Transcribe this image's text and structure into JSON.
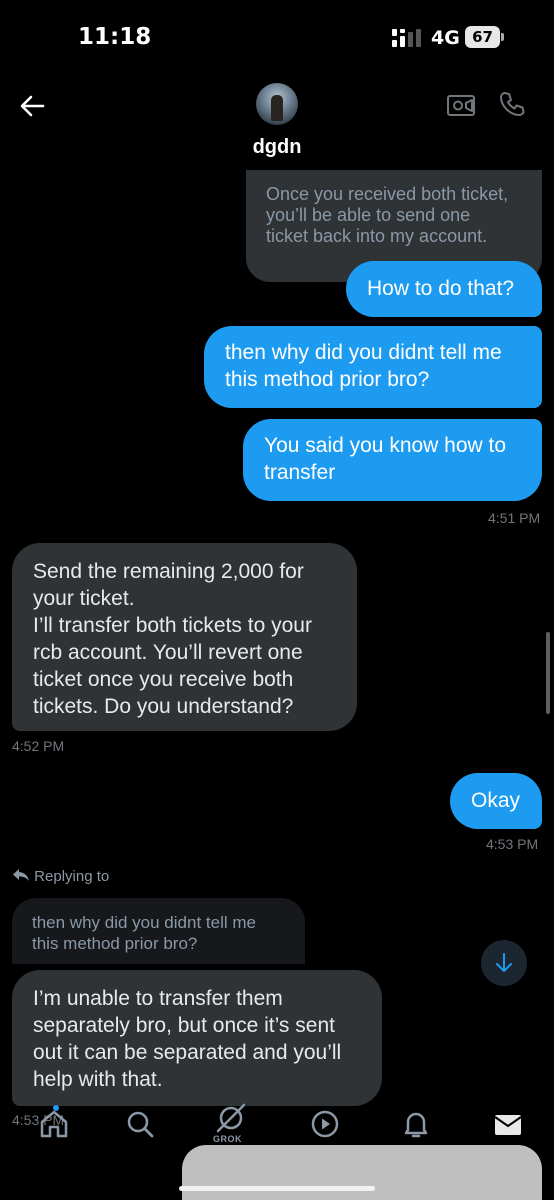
{
  "status_bar": {
    "time": "11:18",
    "network": "4G",
    "battery": "67"
  },
  "header": {
    "contact_name": "dgdn"
  },
  "messages": [
    {
      "from": "them",
      "text": "Once you received both ticket,\nyou’ll be able to send one\nticket back into my account."
    },
    {
      "from": "me",
      "text": "How to do that?"
    },
    {
      "from": "me",
      "text": "then why did you didnt tell me\nthis method prior bro?"
    },
    {
      "from": "me",
      "text": "You said you know how to\ntransfer"
    },
    {
      "from": "me_time",
      "text": "4:51 PM"
    },
    {
      "from": "them",
      "text": "Send the remaining 2,000 for\nyour ticket.\nI’ll transfer both tickets to your\nrcb account. You’ll revert one\nticket once you receive both\ntickets. Do you understand?"
    },
    {
      "from": "them_time",
      "text": "4:52 PM"
    },
    {
      "from": "me",
      "text": "Okay"
    },
    {
      "from": "me_time",
      "text": "4:53 PM"
    },
    {
      "from": "replying",
      "text": "Replying to"
    },
    {
      "from": "quote",
      "text": "then why did you didnt tell me\nthis method prior bro?"
    },
    {
      "from": "them",
      "text": "I’m unable to transfer them\nseparately bro, but once it’s sent\nout it can be separated and you’ll\nhelp with that."
    },
    {
      "from": "them_time",
      "text": "4:53 PM"
    }
  ],
  "bottom_nav": {
    "items": [
      "home-icon",
      "search-icon",
      "grok-icon",
      "video-play-icon",
      "bell-icon",
      "mail-icon"
    ],
    "grok_label": "GROK"
  },
  "colors": {
    "accent": "#1d9bf0",
    "incoming_bubble": "#2f3336",
    "background": "#000000"
  }
}
